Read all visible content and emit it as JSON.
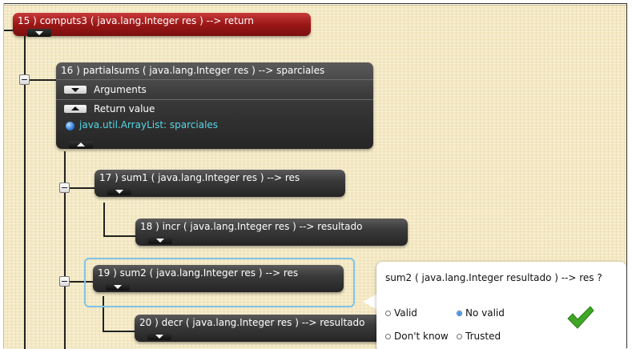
{
  "nodes": {
    "n15": {
      "title": "15 )  computs3 ( java.lang.Integer res ) --> return"
    },
    "n16": {
      "title": "16 )  partialsums ( java.lang.Integer res ) --> sparciales",
      "arguments_label": "Arguments",
      "return_label": "Return value",
      "return_value": "java.util.ArrayList: sparciales"
    },
    "n17": {
      "title": "17 )  sum1 ( java.lang.Integer res ) --> res"
    },
    "n18": {
      "title": "18 )  incr ( java.lang.Integer res ) --> resultado"
    },
    "n19": {
      "title": "19 )  sum2 ( java.lang.Integer res ) --> res"
    },
    "n20": {
      "title": "20 )  decr ( java.lang.Integer res ) --> resultado"
    }
  },
  "question_popup": {
    "question": "sum2 ( java.lang.Integer resultado ) --> res ?",
    "options": [
      {
        "label": "Valid",
        "checked": false
      },
      {
        "label": "No valid",
        "checked": true
      },
      {
        "label": "Don't know",
        "checked": false
      },
      {
        "label": "Trusted",
        "checked": false
      }
    ],
    "confirm_icon": "checkmark-icon"
  },
  "colors": {
    "background": "#f4e9c3",
    "node_dark": "#2e2e2e",
    "node_selected_red": "#9b1717",
    "return_value_text": "#58d7e6",
    "highlight_border": "#7ec3ea",
    "confirm_green": "#3fa626"
  }
}
